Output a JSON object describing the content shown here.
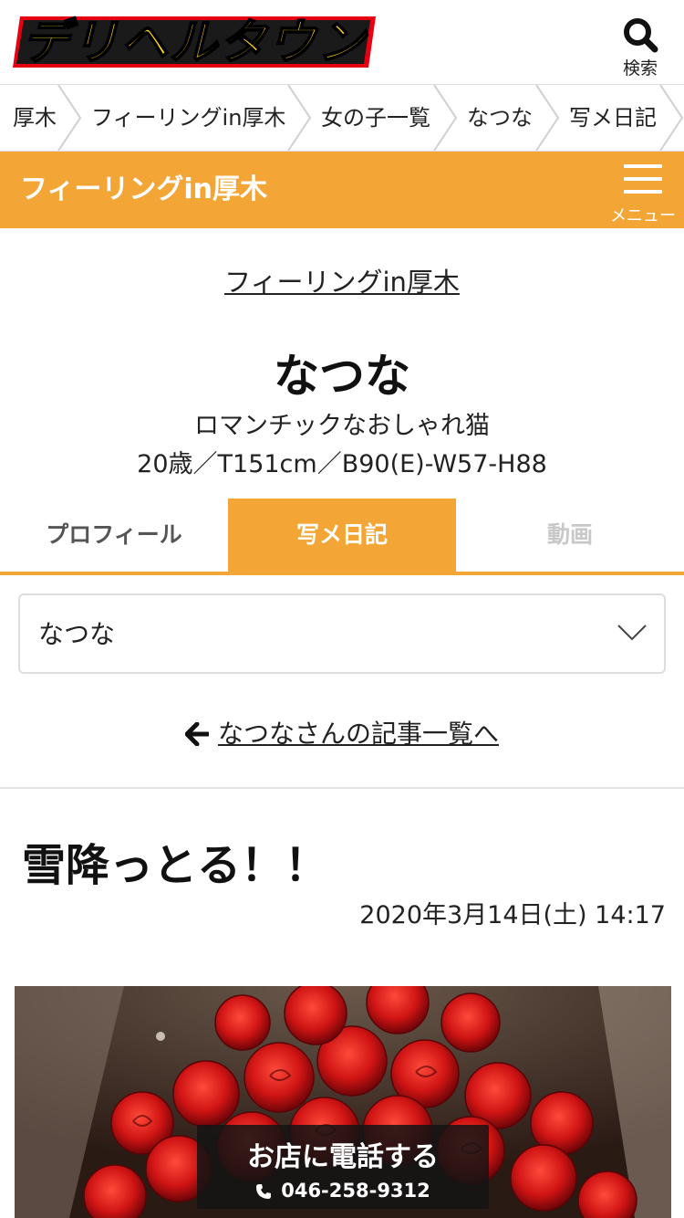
{
  "header": {
    "logo_text": "デリヘルタウン",
    "search_label": "検索"
  },
  "breadcrumb": [
    {
      "label": "厚木"
    },
    {
      "label": "フィーリングin厚木"
    },
    {
      "label": "女の子一覧"
    },
    {
      "label": "なつな"
    },
    {
      "label": "写メ日記"
    }
  ],
  "shop_bar": {
    "title": "フィーリングin厚木",
    "menu_label": "メニュー"
  },
  "profile": {
    "shop_link": "フィーリングin厚木",
    "name": "なつな",
    "catch_copy": "ロマンチックなおしゃれ猫",
    "spec": "20歳／T151cm／B90(E)-W57-H88"
  },
  "tabs": [
    {
      "label": "プロフィール",
      "state": "default"
    },
    {
      "label": "写メ日記",
      "state": "active"
    },
    {
      "label": "動画",
      "state": "disabled"
    }
  ],
  "girl_select": {
    "selected": "なつな"
  },
  "back_link": {
    "label": "なつなさんの記事一覧へ"
  },
  "post": {
    "title": "雪降っとる！！",
    "date": "2020年3月14日(土) 14:17"
  },
  "call_button": {
    "title": "お店に電話する",
    "number": "046-258-9312"
  },
  "colors": {
    "accent": "#f3a636",
    "logo_yellow": "#ffd21f",
    "logo_red": "#e60012"
  },
  "icons": {
    "search": "search-icon",
    "menu": "hamburger-icon",
    "back": "arrow-left-icon",
    "select": "chevron-down-icon",
    "phone": "phone-icon"
  }
}
